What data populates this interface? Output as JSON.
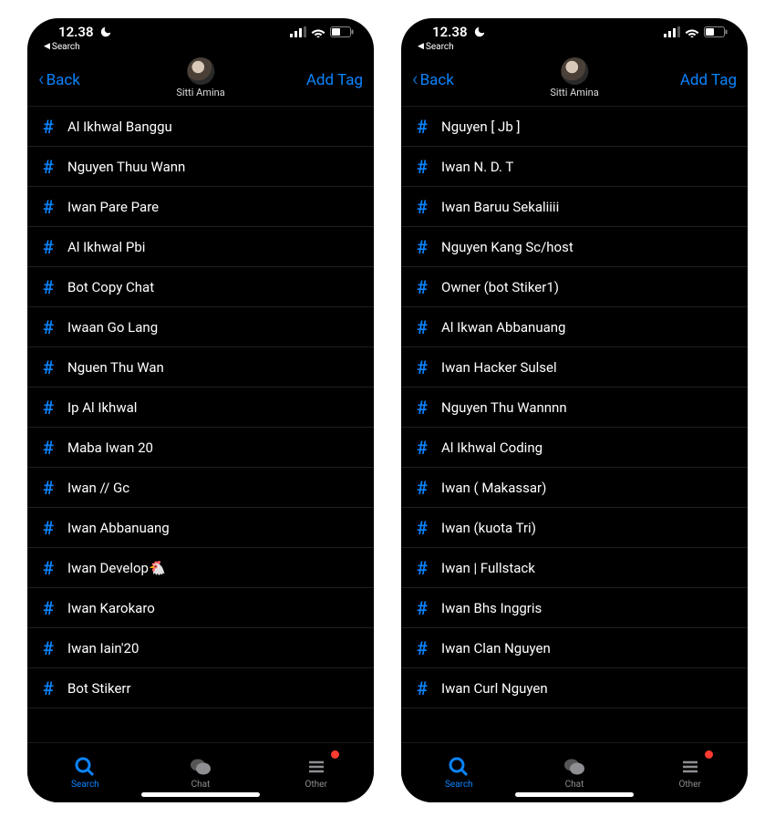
{
  "status": {
    "time": "12.38",
    "back_hint": "Search"
  },
  "nav": {
    "back_label": "Back",
    "title": "Sitti Amina",
    "add_label": "Add Tag"
  },
  "tabs": {
    "search": "Search",
    "chat": "Chat",
    "other": "Other"
  },
  "left_list": [
    "Al Ikhwal Banggu",
    "Nguyen Thuu Wann",
    "Iwan Pare Pare",
    "Al Ikhwal Pbi",
    "Bot Copy Chat",
    "Iwaan Go Lang",
    "Nguen Thu Wan",
    "Ip Al Ikhwal",
    "Maba Iwan 20",
    "Iwan // Gc",
    "Iwan Abbanuang",
    "Iwan Develop🐔",
    "Iwan Karokaro",
    "Iwan Iain'20",
    "Bot Stikerr"
  ],
  "right_list": [
    "Nguyen [ Jb ]",
    "Iwan N. D. T",
    "Iwan Baruu Sekaliiii",
    "Nguyen Kang Sc/host",
    "Owner (bot Stiker1)",
    "Al Ikwan Abbanuang",
    "Iwan Hacker Sulsel",
    "Nguyen Thu Wannnn",
    "Al Ikhwal Coding",
    "Iwan ( Makassar)",
    "Iwan (kuota Tri)",
    "Iwan | Fullstack",
    "Iwan Bhs Inggris",
    "Iwan Clan Nguyen",
    "Iwan Curl Nguyen"
  ]
}
